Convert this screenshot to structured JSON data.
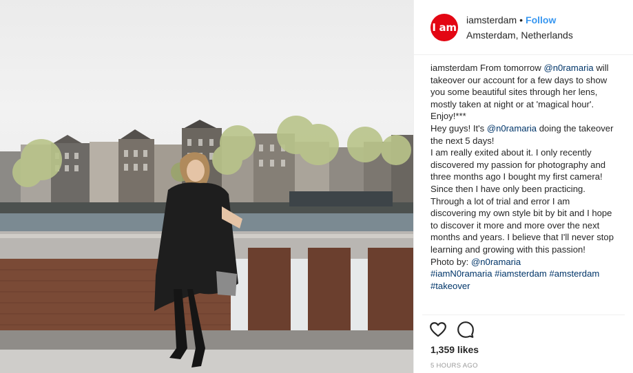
{
  "post": {
    "username": "iamsterdam",
    "separator": "•",
    "follow_label": "Follow",
    "location": "Amsterdam, Netherlands",
    "avatar_text": "I am",
    "brand_color": "#e30613",
    "link_color": "#003569",
    "follow_color": "#3897f0"
  },
  "caption": {
    "username": "iamsterdam",
    "p1": " From tomorrow ",
    "m1": "@n0ramaria",
    "p2": " will takeover our account for a few days to show you some beautiful sites through her lens, mostly taken at night or at 'magical hour'. Enjoy!***\nHey guys! It's ",
    "m2": "@n0ramaria",
    "p3": " doing the takeover the next 5 days!\nI am really exited about it. I only recently discovered my passion for photography and three months ago I bought my first camera! Since then I have only been practicing. Through a lot of trial and error I am discovering my own style bit by bit and I hope to discover it more and more over the next months and years. I believe that I'll never stop learning and growing with this passion!\nPhoto by: ",
    "m3": "@n0ramaria",
    "nl": "\n",
    "h1": "#iamN0ramaria",
    "h2": "#iamsterdam",
    "h3": "#amsterdam",
    "h4": "#takeover"
  },
  "stats": {
    "likes": "1,359 likes",
    "time": "5 HOURS AGO"
  },
  "icons": {
    "like": "heart-icon",
    "comment": "comment-icon"
  }
}
